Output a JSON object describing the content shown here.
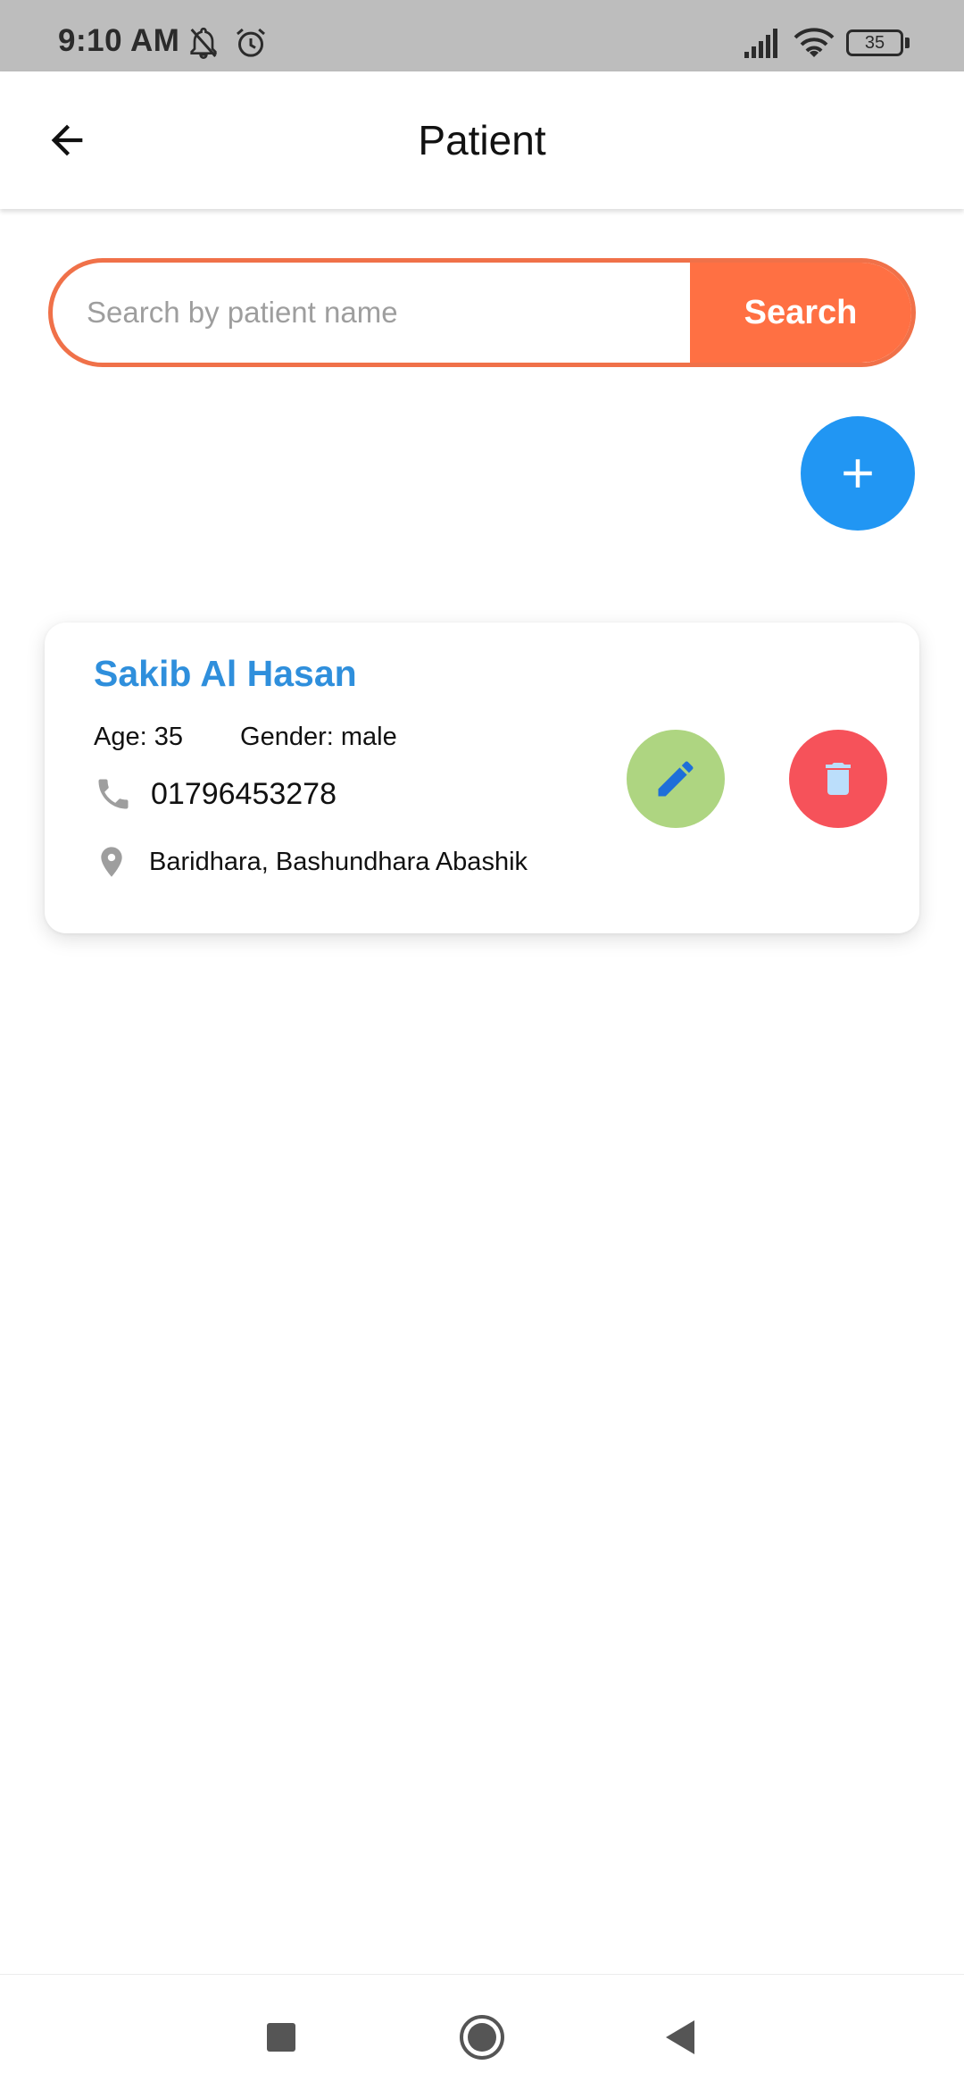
{
  "status_bar": {
    "time": "9:10 AM",
    "battery": "35",
    "icons": [
      "mute-icon",
      "alarm-icon",
      "signal-icon",
      "wifi-icon",
      "battery-icon"
    ]
  },
  "app_bar": {
    "title": "Patient",
    "back_icon": "arrow-back-icon"
  },
  "search": {
    "placeholder": "Search by patient name",
    "value": "",
    "button_label": "Search",
    "accent_color": "#ff7043"
  },
  "fab": {
    "icon": "plus-icon",
    "color": "#2196f3"
  },
  "patients": [
    {
      "name": "Sakib Al Hasan",
      "age_label": "Age: 35",
      "gender_label": "Gender: male",
      "phone": "01796453278",
      "address": "Baridhara, Bashundhara Abashik",
      "edit_icon": "pencil-icon",
      "delete_icon": "trash-icon"
    }
  ],
  "colors": {
    "name": "#2f8fdc",
    "edit_button": "#aed581",
    "delete_button": "#f6525a"
  },
  "nav_bar": {
    "icons": [
      "recents-square-icon",
      "home-circle-icon",
      "back-triangle-icon"
    ]
  }
}
